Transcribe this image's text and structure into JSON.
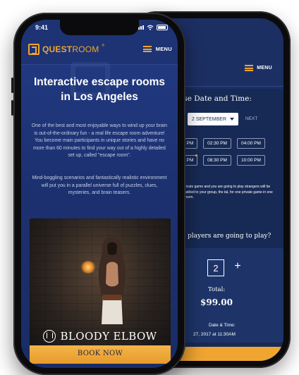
{
  "back_phone": {
    "menu_label": "MENU",
    "choose_title": "ose Date and Time:",
    "selected_date": "2 SEPTEMBER",
    "next_label": "NEXT",
    "time_slots_row1": [
      "00 PM",
      "02:30 PM",
      "04:00 PM"
    ],
    "time_slots_row2": [
      "00 PM",
      "08:30 PM",
      "10:00 PM"
    ],
    "private_note": "rivate game and you are going to play strangers will be added to your group, the tal, for one private game in one room.",
    "players_question": "players are going to play?",
    "player_count": "2",
    "minus_label": "",
    "plus_label": "+",
    "total_label": "Total:",
    "total_value": "$99.00",
    "datetime_label": "Date & Time:",
    "datetime_value": "27, 2017 at 11:30AM"
  },
  "status": {
    "time": "9:41"
  },
  "header": {
    "logo_text_bold": "QUEST",
    "logo_text": "ROOM",
    "logo_reg": "®",
    "menu_label": "MENU"
  },
  "hero": {
    "title": "Interactive escape rooms in Los Angeles",
    "intro": "One of the best and most enjoyable ways to wind up your brain is out-of-the-ordinary fun - a real life escape room adventure! You become main participants in unique stories and have no more than 60 minutes to find your way out of a highly detailed set up, called \"escape room\".",
    "intro2": "Mind-boggling scenarios and fantastically realistic environment will put you in a parallel universe full of puzzles, clues, mysteries, and brain teasers."
  },
  "room_card": {
    "name": "BLOODY ELBOW",
    "cta": "BOOK NOW"
  },
  "colors": {
    "accent": "#f0a531",
    "navy": "#1d3373",
    "navy_dark": "#172a55"
  }
}
